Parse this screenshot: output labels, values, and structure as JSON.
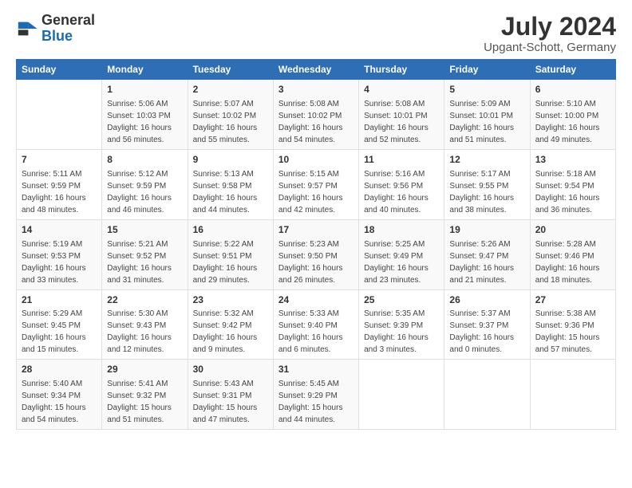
{
  "header": {
    "logo_general": "General",
    "logo_blue": "Blue",
    "main_title": "July 2024",
    "subtitle": "Upgant-Schott, Germany"
  },
  "days_of_week": [
    "Sunday",
    "Monday",
    "Tuesday",
    "Wednesday",
    "Thursday",
    "Friday",
    "Saturday"
  ],
  "weeks": [
    [
      {
        "day": "",
        "sunrise": "",
        "sunset": "",
        "daylight": ""
      },
      {
        "day": "1",
        "sunrise": "Sunrise: 5:06 AM",
        "sunset": "Sunset: 10:03 PM",
        "daylight": "Daylight: 16 hours and 56 minutes."
      },
      {
        "day": "2",
        "sunrise": "Sunrise: 5:07 AM",
        "sunset": "Sunset: 10:02 PM",
        "daylight": "Daylight: 16 hours and 55 minutes."
      },
      {
        "day": "3",
        "sunrise": "Sunrise: 5:08 AM",
        "sunset": "Sunset: 10:02 PM",
        "daylight": "Daylight: 16 hours and 54 minutes."
      },
      {
        "day": "4",
        "sunrise": "Sunrise: 5:08 AM",
        "sunset": "Sunset: 10:01 PM",
        "daylight": "Daylight: 16 hours and 52 minutes."
      },
      {
        "day": "5",
        "sunrise": "Sunrise: 5:09 AM",
        "sunset": "Sunset: 10:01 PM",
        "daylight": "Daylight: 16 hours and 51 minutes."
      },
      {
        "day": "6",
        "sunrise": "Sunrise: 5:10 AM",
        "sunset": "Sunset: 10:00 PM",
        "daylight": "Daylight: 16 hours and 49 minutes."
      }
    ],
    [
      {
        "day": "7",
        "sunrise": "Sunrise: 5:11 AM",
        "sunset": "Sunset: 9:59 PM",
        "daylight": "Daylight: 16 hours and 48 minutes."
      },
      {
        "day": "8",
        "sunrise": "Sunrise: 5:12 AM",
        "sunset": "Sunset: 9:59 PM",
        "daylight": "Daylight: 16 hours and 46 minutes."
      },
      {
        "day": "9",
        "sunrise": "Sunrise: 5:13 AM",
        "sunset": "Sunset: 9:58 PM",
        "daylight": "Daylight: 16 hours and 44 minutes."
      },
      {
        "day": "10",
        "sunrise": "Sunrise: 5:15 AM",
        "sunset": "Sunset: 9:57 PM",
        "daylight": "Daylight: 16 hours and 42 minutes."
      },
      {
        "day": "11",
        "sunrise": "Sunrise: 5:16 AM",
        "sunset": "Sunset: 9:56 PM",
        "daylight": "Daylight: 16 hours and 40 minutes."
      },
      {
        "day": "12",
        "sunrise": "Sunrise: 5:17 AM",
        "sunset": "Sunset: 9:55 PM",
        "daylight": "Daylight: 16 hours and 38 minutes."
      },
      {
        "day": "13",
        "sunrise": "Sunrise: 5:18 AM",
        "sunset": "Sunset: 9:54 PM",
        "daylight": "Daylight: 16 hours and 36 minutes."
      }
    ],
    [
      {
        "day": "14",
        "sunrise": "Sunrise: 5:19 AM",
        "sunset": "Sunset: 9:53 PM",
        "daylight": "Daylight: 16 hours and 33 minutes."
      },
      {
        "day": "15",
        "sunrise": "Sunrise: 5:21 AM",
        "sunset": "Sunset: 9:52 PM",
        "daylight": "Daylight: 16 hours and 31 minutes."
      },
      {
        "day": "16",
        "sunrise": "Sunrise: 5:22 AM",
        "sunset": "Sunset: 9:51 PM",
        "daylight": "Daylight: 16 hours and 29 minutes."
      },
      {
        "day": "17",
        "sunrise": "Sunrise: 5:23 AM",
        "sunset": "Sunset: 9:50 PM",
        "daylight": "Daylight: 16 hours and 26 minutes."
      },
      {
        "day": "18",
        "sunrise": "Sunrise: 5:25 AM",
        "sunset": "Sunset: 9:49 PM",
        "daylight": "Daylight: 16 hours and 23 minutes."
      },
      {
        "day": "19",
        "sunrise": "Sunrise: 5:26 AM",
        "sunset": "Sunset: 9:47 PM",
        "daylight": "Daylight: 16 hours and 21 minutes."
      },
      {
        "day": "20",
        "sunrise": "Sunrise: 5:28 AM",
        "sunset": "Sunset: 9:46 PM",
        "daylight": "Daylight: 16 hours and 18 minutes."
      }
    ],
    [
      {
        "day": "21",
        "sunrise": "Sunrise: 5:29 AM",
        "sunset": "Sunset: 9:45 PM",
        "daylight": "Daylight: 16 hours and 15 minutes."
      },
      {
        "day": "22",
        "sunrise": "Sunrise: 5:30 AM",
        "sunset": "Sunset: 9:43 PM",
        "daylight": "Daylight: 16 hours and 12 minutes."
      },
      {
        "day": "23",
        "sunrise": "Sunrise: 5:32 AM",
        "sunset": "Sunset: 9:42 PM",
        "daylight": "Daylight: 16 hours and 9 minutes."
      },
      {
        "day": "24",
        "sunrise": "Sunrise: 5:33 AM",
        "sunset": "Sunset: 9:40 PM",
        "daylight": "Daylight: 16 hours and 6 minutes."
      },
      {
        "day": "25",
        "sunrise": "Sunrise: 5:35 AM",
        "sunset": "Sunset: 9:39 PM",
        "daylight": "Daylight: 16 hours and 3 minutes."
      },
      {
        "day": "26",
        "sunrise": "Sunrise: 5:37 AM",
        "sunset": "Sunset: 9:37 PM",
        "daylight": "Daylight: 16 hours and 0 minutes."
      },
      {
        "day": "27",
        "sunrise": "Sunrise: 5:38 AM",
        "sunset": "Sunset: 9:36 PM",
        "daylight": "Daylight: 15 hours and 57 minutes."
      }
    ],
    [
      {
        "day": "28",
        "sunrise": "Sunrise: 5:40 AM",
        "sunset": "Sunset: 9:34 PM",
        "daylight": "Daylight: 15 hours and 54 minutes."
      },
      {
        "day": "29",
        "sunrise": "Sunrise: 5:41 AM",
        "sunset": "Sunset: 9:32 PM",
        "daylight": "Daylight: 15 hours and 51 minutes."
      },
      {
        "day": "30",
        "sunrise": "Sunrise: 5:43 AM",
        "sunset": "Sunset: 9:31 PM",
        "daylight": "Daylight: 15 hours and 47 minutes."
      },
      {
        "day": "31",
        "sunrise": "Sunrise: 5:45 AM",
        "sunset": "Sunset: 9:29 PM",
        "daylight": "Daylight: 15 hours and 44 minutes."
      },
      {
        "day": "",
        "sunrise": "",
        "sunset": "",
        "daylight": ""
      },
      {
        "day": "",
        "sunrise": "",
        "sunset": "",
        "daylight": ""
      },
      {
        "day": "",
        "sunrise": "",
        "sunset": "",
        "daylight": ""
      }
    ]
  ]
}
